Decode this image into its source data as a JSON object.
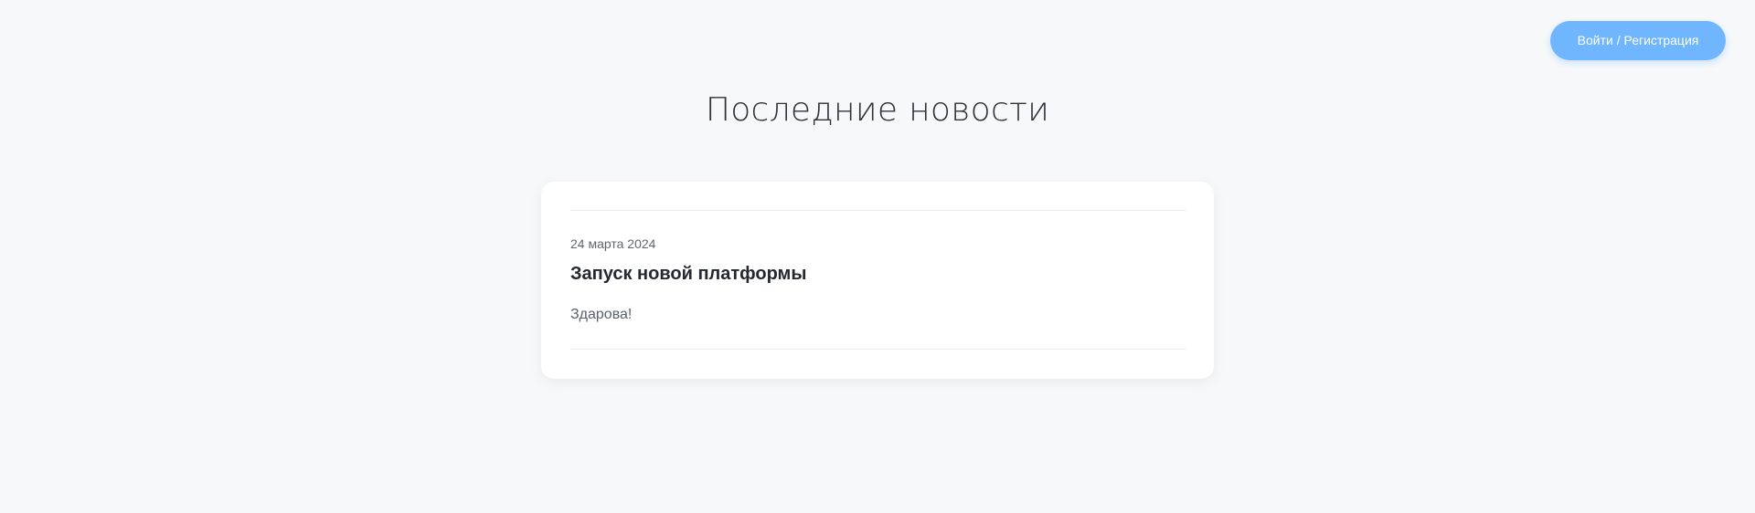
{
  "header": {
    "auth_label": "Войти / Регистрация"
  },
  "main": {
    "title": "Последние новости",
    "news": [
      {
        "date": "24 марта 2024",
        "title": "Запуск новой платформы",
        "body": "Здарова!"
      }
    ]
  },
  "colors": {
    "background": "#f7f8fa",
    "accent": "#6fb6ff",
    "card": "#ffffff"
  }
}
